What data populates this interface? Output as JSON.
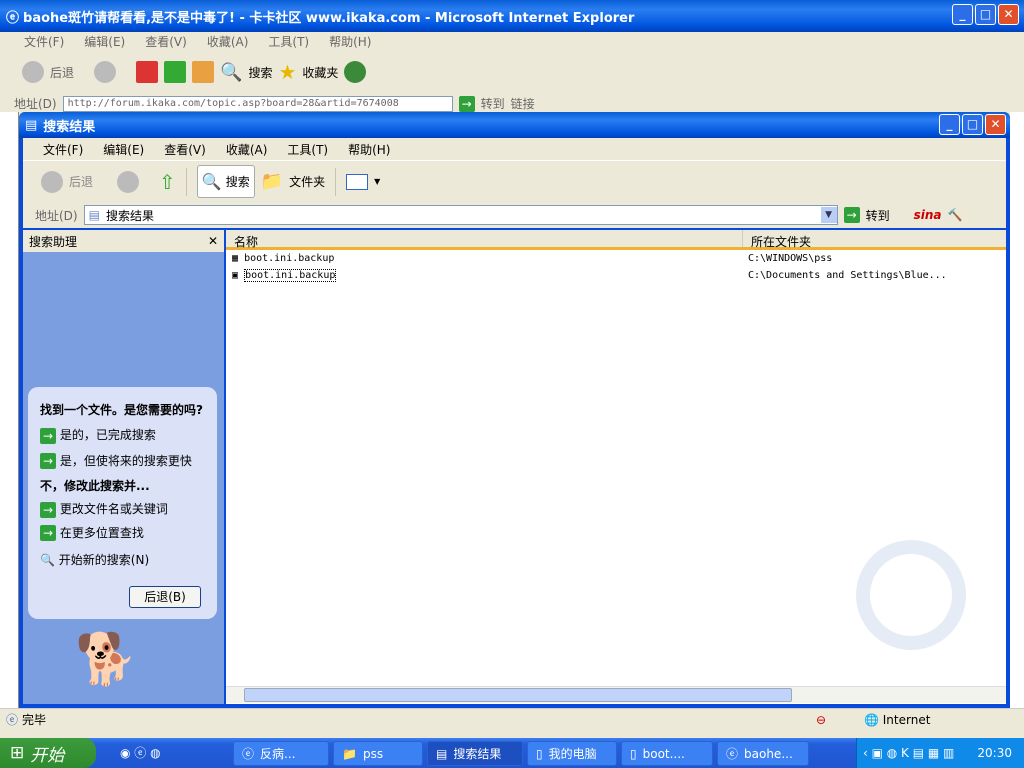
{
  "ie": {
    "title": "baohe斑竹请帮看看,是不是中毒了! - 卡卡社区 www.ikaka.com - Microsoft Internet Explorer",
    "menu": [
      "文件(F)",
      "编辑(E)",
      "查看(V)",
      "收藏(A)",
      "工具(T)",
      "帮助(H)"
    ],
    "toolbar": {
      "back": "后退",
      "search": "搜索",
      "favorites": "收藏夹"
    },
    "address_label": "地址(D)",
    "address": "http://forum.ikaka.com/topic.asp?board=28&artid=7674008",
    "go": "转到",
    "links": "链接",
    "status": "完毕",
    "zone": "Internet"
  },
  "explorer": {
    "title": "搜索结果",
    "menu": [
      "文件(F)",
      "编辑(E)",
      "查看(V)",
      "收藏(A)",
      "工具(T)",
      "帮助(H)"
    ],
    "toolbar": {
      "back": "后退",
      "search": "搜索",
      "folders": "文件夹"
    },
    "address_label": "地址(D)",
    "address": "搜索结果",
    "go": "转到",
    "assistant": {
      "title": "搜索助理",
      "question": "找到一个文件。是您需要的吗?",
      "yes_done": "是的，已完成搜索",
      "yes_faster": "是，但使将来的搜索更快",
      "no_heading": "不，修改此搜索并...",
      "change_name": "更改文件名或关键词",
      "more_locations": "在更多位置查找",
      "new_search": "开始新的搜索(N)",
      "back": "后退(B)"
    },
    "columns": [
      "名称",
      "所在文件夹"
    ],
    "files": [
      {
        "name": "boot.ini.backup",
        "folder": "C:\\WINDOWS\\pss"
      },
      {
        "name": "boot.ini.backup",
        "folder": "C:\\Documents and Settings\\Blue..."
      }
    ]
  },
  "taskbar": {
    "start": "开始",
    "tasks": [
      "反病...",
      "pss",
      "搜索结果",
      "我的电脑",
      "boot....",
      "baohe..."
    ],
    "clock": "20:30"
  }
}
